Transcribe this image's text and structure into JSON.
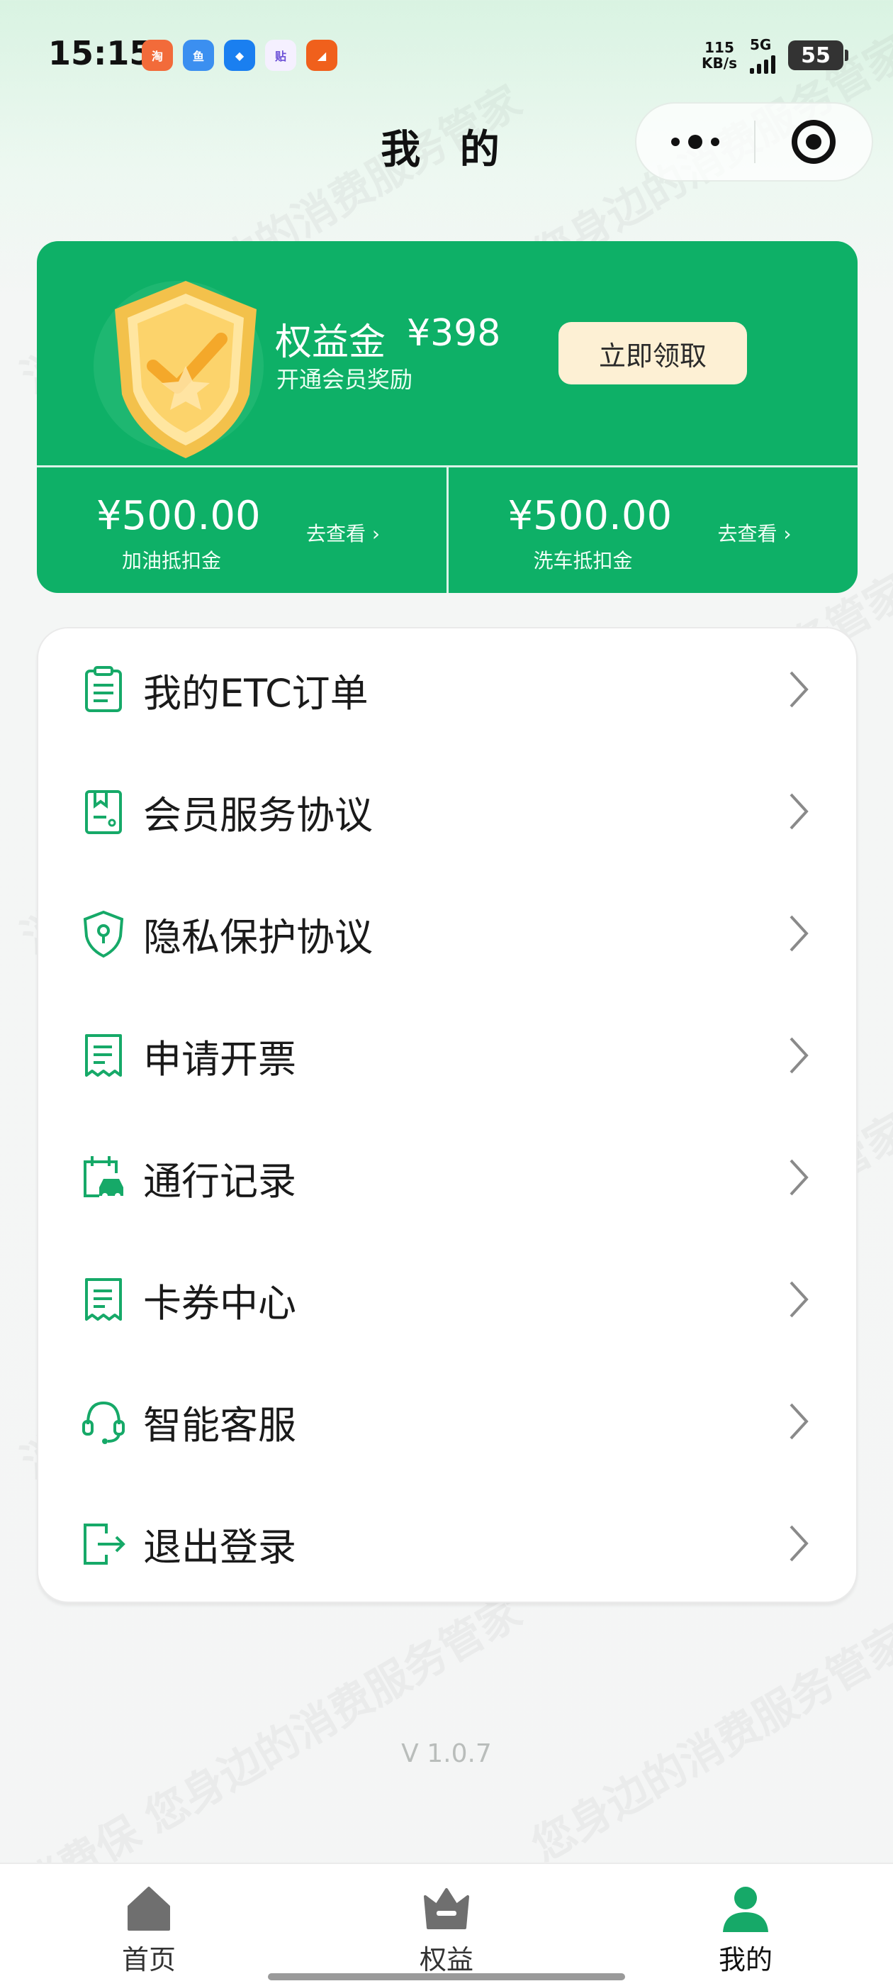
{
  "status_bar": {
    "time": "15:15",
    "notification_icons": [
      "taobao-flash-icon",
      "xianyu-live-icon",
      "blue-app-icon",
      "tieba-icon",
      "orange-app-icon"
    ],
    "net_speed_value": "115",
    "net_speed_unit": "KB/s",
    "network": "5G",
    "battery": "55"
  },
  "header": {
    "title": "我 的"
  },
  "rewards_card": {
    "bonus_label": "权益金",
    "bonus_amount": "¥398",
    "bonus_subtitle": "开通会员奖励",
    "claim_button": "立即领取",
    "coupons": [
      {
        "amount": "¥500.00",
        "label": "加油抵扣金",
        "link": "去查看 ›"
      },
      {
        "amount": "¥500.00",
        "label": "洗车抵扣金",
        "link": "去查看 ›"
      }
    ]
  },
  "menu": {
    "items": [
      {
        "label": "我的ETC订单",
        "icon": "clipboard-icon"
      },
      {
        "label": "会员服务协议",
        "icon": "bookmark-document-icon"
      },
      {
        "label": "隐私保护协议",
        "icon": "shield-lock-icon"
      },
      {
        "label": "申请开票",
        "icon": "receipt-icon"
      },
      {
        "label": "通行记录",
        "icon": "car-calendar-icon"
      },
      {
        "label": "卡券中心",
        "icon": "coupon-receipt-icon"
      },
      {
        "label": "智能客服",
        "icon": "headset-icon"
      },
      {
        "label": "退出登录",
        "icon": "logout-icon"
      }
    ]
  },
  "version": "V 1.0.7",
  "tab_bar": {
    "tabs": [
      {
        "label": "首页",
        "icon": "home-icon",
        "active": false
      },
      {
        "label": "权益",
        "icon": "crown-icon",
        "active": false
      },
      {
        "label": "我的",
        "icon": "user-icon",
        "active": true
      }
    ]
  },
  "watermark": {
    "text_a": "消费保 您身边的消费服务管家",
    "text_b": "您身边的消费服务管家 消费保"
  },
  "colors": {
    "brand_green": "#0eb067",
    "claim_button_bg": "#fdf0d4",
    "icon_green": "#16a968",
    "inactive_tab": "#777777"
  }
}
